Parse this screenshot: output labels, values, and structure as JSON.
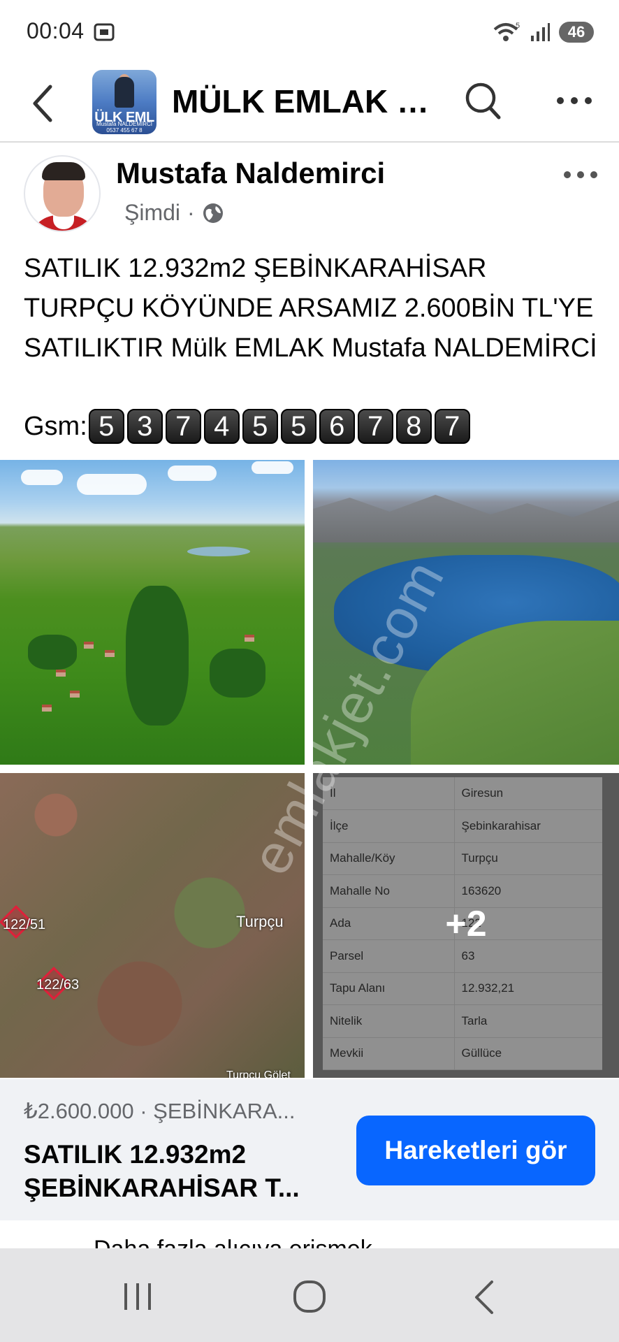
{
  "status_bar": {
    "time": "00:04",
    "battery": "46",
    "wifi_badge": "5"
  },
  "header": {
    "title": "MÜLK EMLAK G...",
    "avatar_text": "ÜLK EML",
    "avatar_subtext": "Mustafa NALDEMİRCİ 0537 455 67 8"
  },
  "post": {
    "author": "Mustafa Naldemirci",
    "time": "Şimdi",
    "separator": "·",
    "text": "SATILIK 12.932m2 ŞEBİNKARAHİSAR TURPÇU KÖYÜNDE ARSAMIZ 2.600BİN TL'YE SATILIKTIR Mülk EMLAK Mustafa NALDEMİRCİ",
    "gsm_label": "Gsm:",
    "gsm_digits": [
      "5",
      "3",
      "7",
      "4",
      "5",
      "5",
      "6",
      "7",
      "8",
      "7"
    ]
  },
  "photos": {
    "map_labels": {
      "parcel_a": "122/51",
      "parcel_b": "122/63",
      "village": "Turpçu",
      "bottom": "Turpçu Gölet"
    },
    "parcel_table": [
      [
        "İl",
        "Giresun"
      ],
      [
        "İlçe",
        "Şebinkarahisar"
      ],
      [
        "Mahalle/Köy",
        "Turpçu"
      ],
      [
        "Mahalle No",
        "163620"
      ],
      [
        "Ada",
        "122"
      ],
      [
        "Parsel",
        "63"
      ],
      [
        "Tapu Alanı",
        "12.932,21"
      ],
      [
        "Nitelik",
        "Tarla"
      ],
      [
        "Mevkii",
        "Güllüce"
      ]
    ],
    "more_count": "+2",
    "watermark": "emlakjet.com"
  },
  "listing": {
    "price_location": "₺2.600.000 · ŞEBİNKARA...",
    "title_line1": "SATILIK 12.932m2",
    "title_line2": "ŞEBİNKARAHİSAR T...",
    "button": "Hareketleri gör"
  },
  "partial_text": "Daha fazla alıcıya erişmek",
  "icons": {
    "back": "back-arrow-icon",
    "search": "search-icon",
    "more": "more-horizontal-icon",
    "globe": "globe-icon"
  },
  "colors": {
    "accent": "#0866ff",
    "meta_text": "#65676b",
    "card_bg": "#f0f2f5"
  }
}
